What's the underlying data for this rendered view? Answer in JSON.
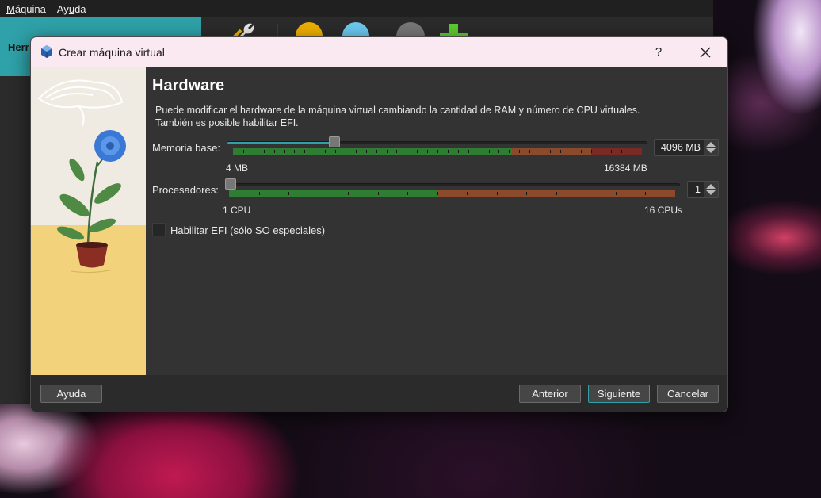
{
  "manager": {
    "menu": [
      {
        "label": "Máquina"
      },
      {
        "label": "Ayuda"
      }
    ],
    "tools_label": "Herr"
  },
  "dialog": {
    "title": "Crear máquina virtual",
    "help_glyph": "?",
    "page_title": "Hardware",
    "description_line1": "Puede modificar el hardware de la máquina virtual cambiando la cantidad de RAM y número de CPU virtuales.",
    "description_line2": "También es posible habilitar EFI.",
    "memory": {
      "label": "Memoria base:",
      "min_label": "4 MB",
      "max_label": "16384 MB",
      "value_text": "4096 MB",
      "value": 4096,
      "min": 4,
      "max": 16384
    },
    "processors": {
      "label": "Procesadores:",
      "min_label": "1 CPU",
      "max_label": "16 CPUs",
      "value_text": "1",
      "value": 1,
      "min": 1,
      "max": 16
    },
    "efi": {
      "label": "Habilitar EFI (sólo SO especiales)",
      "checked": false
    },
    "buttons": {
      "help": "Ayuda",
      "back": "Anterior",
      "next": "Siguiente",
      "cancel": "Cancelar"
    }
  },
  "colors": {
    "accent": "#2fa1a8",
    "range_safe": "#2e7d32",
    "range_warn": "#8b4a2b",
    "range_danger": "#7a2a24",
    "titlebar": "#fbe9f1"
  }
}
